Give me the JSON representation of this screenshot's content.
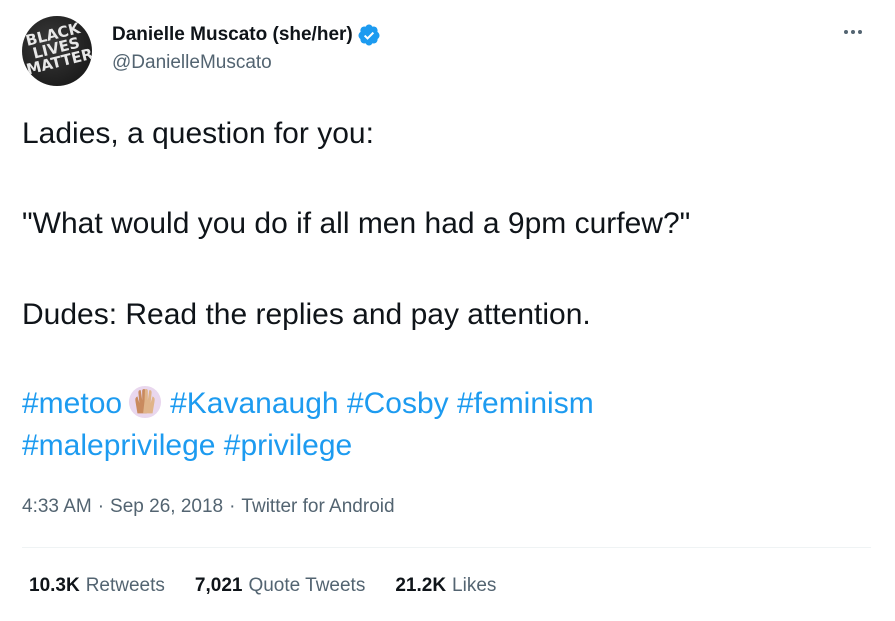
{
  "author": {
    "display_name": "Danielle Muscato (she/her)",
    "handle": "@DanielleMuscato",
    "verified": true,
    "avatar_text": [
      "BLACK",
      "LIVES",
      "MATTER"
    ]
  },
  "tweet": {
    "line1": "Ladies, a question for you:",
    "line2": "\"What would you do if all men had a 9pm curfew?\"",
    "line3": "Dudes: Read the replies and pay attention.",
    "hashtags": [
      "#metoo",
      "#Kavanaugh",
      "#Cosby",
      "#feminism",
      "#maleprivilege",
      "#privilege"
    ],
    "emoji": "raised-hands-emoji"
  },
  "meta": {
    "time": "4:33 AM",
    "date": "Sep 26, 2018",
    "source": "Twitter for Android",
    "separator": "·"
  },
  "stats": {
    "retweets_count": "10.3K",
    "retweets_label": "Retweets",
    "quotes_count": "7,021",
    "quotes_label": "Quote Tweets",
    "likes_count": "21.2K",
    "likes_label": "Likes"
  },
  "colors": {
    "link": "#1d9bf0",
    "muted": "#536471",
    "text": "#0f1419",
    "verified": "#1d9bf0"
  },
  "icons": {
    "verified": "verified-badge-icon",
    "more": "more-options-icon"
  }
}
